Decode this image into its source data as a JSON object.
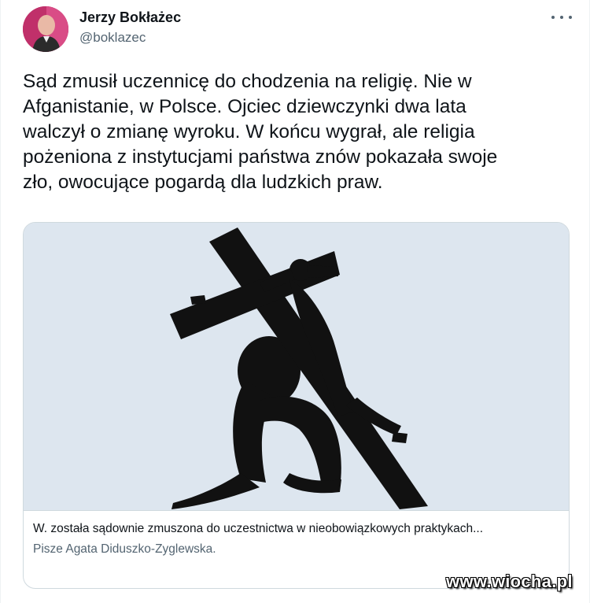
{
  "author": {
    "name": "Jerzy Bokłażec",
    "handle": "@boklazec"
  },
  "tweet": {
    "text": "Sąd zmusił uczennicę do chodzenia na religię. Nie w\nAfganistanie, w Polsce. Ojciec dziewczynki dwa lata\nwalczył o zmianę wyroku. W końcu wygrał, ale religia\npożeniona z instytucjami państwa znów pokazała swoje\nzło, owocujące pogardą dla ludzkich praw."
  },
  "card": {
    "title": "W. została sądownie zmuszona do uczestnictwa w nieobowiązkowych praktykach...",
    "subtitle": "Pisze Agata Diduszko-Zyglewska."
  },
  "watermark": {
    "text": "www.wiocha.pl"
  },
  "icons": {
    "more": "more-horizontal-icon",
    "avatar": "profile-photo"
  },
  "colors": {
    "text_primary": "#0f1419",
    "text_secondary": "#536471",
    "card_border": "#cfd9de",
    "image_background": "#dde6ef",
    "avatar_background": "#c0306a"
  }
}
